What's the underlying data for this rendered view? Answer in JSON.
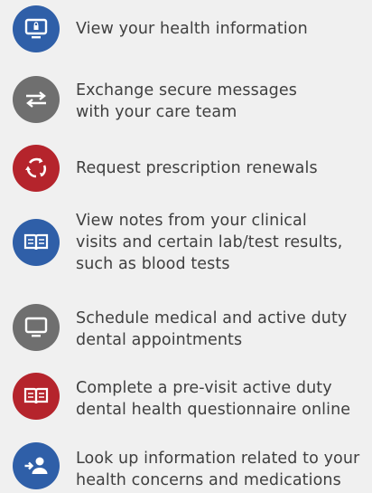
{
  "colors": {
    "blue": "#2f5fa8",
    "gray": "#6f6f6f",
    "red": "#b5242c",
    "background": "#f0f0f0",
    "text": "#3f3f3f"
  },
  "features": [
    {
      "icon": "secure-monitor-icon",
      "color": "blue",
      "lines": [
        "View your health information"
      ]
    },
    {
      "icon": "exchange-arrows-icon",
      "color": "gray",
      "lines": [
        "Exchange secure messages",
        "with your care team"
      ]
    },
    {
      "icon": "refresh-cycle-icon",
      "color": "red",
      "lines": [
        "Request prescription renewals"
      ]
    },
    {
      "icon": "open-book-icon",
      "color": "blue",
      "lines": [
        "View notes from your clinical",
        "visits and certain lab/test results,",
        "such as blood tests"
      ]
    },
    {
      "icon": "monitor-icon",
      "color": "gray",
      "lines": [
        "Schedule medical and active duty",
        "dental appointments"
      ]
    },
    {
      "icon": "open-book-icon",
      "color": "red",
      "lines": [
        "Complete a pre-visit active duty",
        "dental health questionnaire online"
      ]
    },
    {
      "icon": "person-lookup-icon",
      "color": "blue",
      "lines": [
        "Look up information related to your",
        "health concerns and medications"
      ]
    }
  ]
}
